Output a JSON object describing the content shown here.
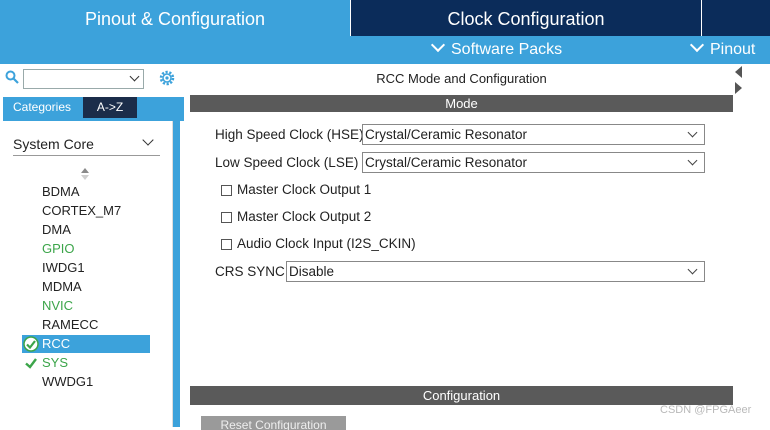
{
  "tabs": {
    "pinout": "Pinout & Configuration",
    "clock": "Clock Configuration"
  },
  "subbar": {
    "software_packs": "Software Packs",
    "pinout": "Pinout"
  },
  "colors": {
    "accent": "#3ca2db",
    "dark_tab": "#0b2c5a",
    "section_bar": "#5a5a5a",
    "green_status": "#3ca54a"
  },
  "left": {
    "search_value": "",
    "tab_categories": "Categories",
    "tab_az": "A->Z",
    "category": "System Core",
    "peripherals": [
      {
        "name": "BDMA",
        "status": "normal"
      },
      {
        "name": "CORTEX_M7",
        "status": "normal"
      },
      {
        "name": "DMA",
        "status": "normal"
      },
      {
        "name": "GPIO",
        "status": "green"
      },
      {
        "name": "IWDG1",
        "status": "normal"
      },
      {
        "name": "MDMA",
        "status": "normal"
      },
      {
        "name": "NVIC",
        "status": "green"
      },
      {
        "name": "RAMECC",
        "status": "normal"
      },
      {
        "name": "RCC",
        "status": "selected-configured"
      },
      {
        "name": "SYS",
        "status": "configured"
      },
      {
        "name": "WWDG1",
        "status": "normal"
      }
    ]
  },
  "right": {
    "title": "RCC Mode and Configuration",
    "mode_header": "Mode",
    "hse_label": "High Speed Clock (HSE)",
    "hse_value": "Crystal/Ceramic Resonator",
    "lse_label": "Low Speed Clock (LSE)",
    "lse_value": "Crystal/Ceramic Resonator",
    "mco1_label": "Master Clock Output 1",
    "mco2_label": "Master Clock Output 2",
    "i2s_label": "Audio Clock Input (I2S_CKIN)",
    "crs_label": "CRS SYNC",
    "crs_value": "Disable",
    "config_header": "Configuration",
    "reset_button": "Reset Configuration"
  },
  "watermark": "CSDN @FPGAeer"
}
